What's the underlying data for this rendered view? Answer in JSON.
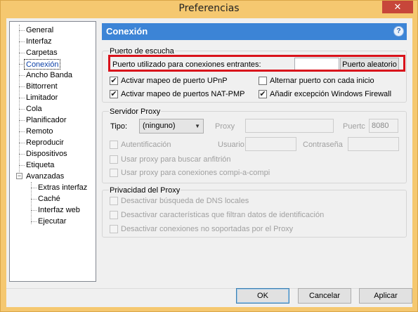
{
  "window": {
    "title": "Preferencias",
    "close_glyph": "✕"
  },
  "tree": {
    "items": [
      {
        "label": "General"
      },
      {
        "label": "Interfaz"
      },
      {
        "label": "Carpetas"
      },
      {
        "label": "Conexión",
        "selected": true
      },
      {
        "label": "Ancho Banda"
      },
      {
        "label": "Bittorrent"
      },
      {
        "label": "Limitador"
      },
      {
        "label": "Cola"
      },
      {
        "label": "Planificador"
      },
      {
        "label": "Remoto"
      },
      {
        "label": "Reproducir"
      },
      {
        "label": "Dispositivos"
      },
      {
        "label": "Etiqueta"
      },
      {
        "label": "Avanzadas",
        "expanded": true
      }
    ],
    "children": [
      {
        "label": "Extras interfaz"
      },
      {
        "label": "Caché"
      },
      {
        "label": "Interfaz web"
      },
      {
        "label": "Ejecutar"
      }
    ],
    "expander_glyph": "−"
  },
  "header": {
    "title": "Conexión",
    "help_glyph": "?"
  },
  "listen_port": {
    "group_title": "Puerto de escucha",
    "port_label": "Puerto utilizado para conexiones entrantes:",
    "port_value": "",
    "random_button": "Puerto aleatorio",
    "upnp_label": "Activar mapeo de puerto UPnP",
    "upnp_checked": true,
    "natpmp_label": "Activar mapeo de puertos NAT-PMP",
    "natpmp_checked": true,
    "alternate_label": "Alternar puerto con cada inicio",
    "alternate_checked": false,
    "firewall_label": "Añadir excepción Windows Firewall",
    "firewall_checked": true
  },
  "proxy": {
    "group_title": "Servidor Proxy",
    "type_label": "Tipo:",
    "type_value": "(ninguno)",
    "proxy_label": "Proxy",
    "proxy_value": "",
    "port_label": "Puertc",
    "port_value": "8080",
    "auth_label": "Autentificación",
    "user_label": "Usuario:",
    "user_value": "",
    "password_label": "Contraseña",
    "password_value": "",
    "hostname_label": "Usar proxy para buscar anfitrión",
    "p2p_label": "Usar proxy para conexiones compi-a-compi"
  },
  "privacy": {
    "group_title": "Privacidad del Proxy",
    "dns_label": "Desactivar búsqueda de DNS locales",
    "features_label": "Desactivar características que filtran datos de identificación",
    "unsupported_label": "Desactivar conexiones no soportadas por el Proxy"
  },
  "footer": {
    "ok": "OK",
    "cancel": "Cancelar",
    "apply": "Aplicar"
  },
  "check_glyph": "✔",
  "dropdown_glyph": "▼",
  "colors": {
    "header": "#3c84d6",
    "highlight": "#d9121b",
    "frame": "#f5c870",
    "close": "#c7463a"
  }
}
